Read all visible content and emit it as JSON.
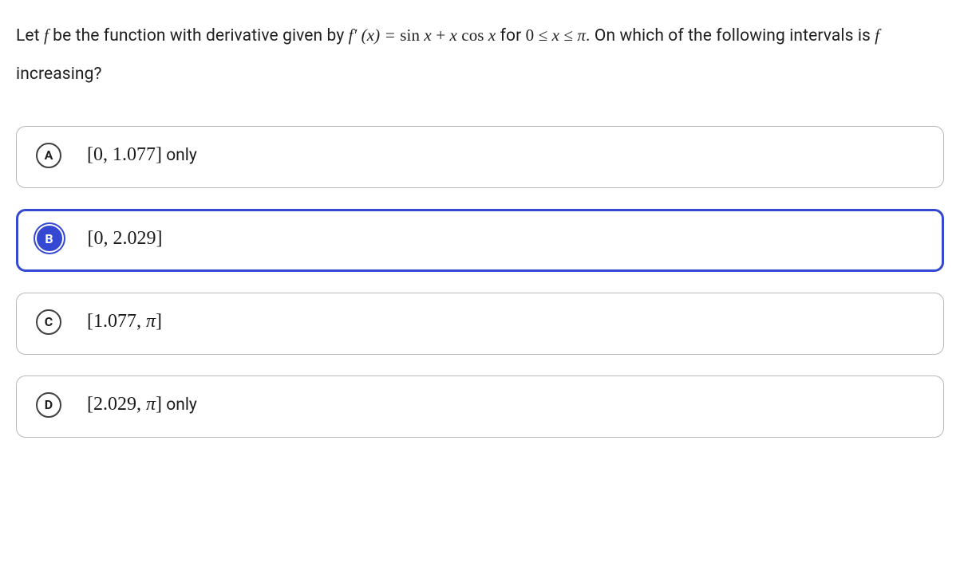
{
  "question": {
    "pre1": "Let ",
    "f1": "f",
    "mid1": " be the function with derivative given by ",
    "deriv_lhs": "f′(x) = ",
    "deriv_rhs": "sin x + x cos x",
    "mid2": " for ",
    "domain": "0 ≤ x ≤ π",
    "post1": ". On which of the following intervals is ",
    "f2": "f",
    "post2": " increasing?"
  },
  "options": [
    {
      "letter": "A",
      "interval": "[0, 1.077]",
      "suffix": " only",
      "selected": false
    },
    {
      "letter": "B",
      "interval": "[0, 2.029]",
      "suffix": "",
      "selected": true
    },
    {
      "letter": "C",
      "interval": "[1.077, π]",
      "suffix": "",
      "selected": false
    },
    {
      "letter": "D",
      "interval": "[2.029, π]",
      "suffix": " only",
      "selected": false
    }
  ]
}
